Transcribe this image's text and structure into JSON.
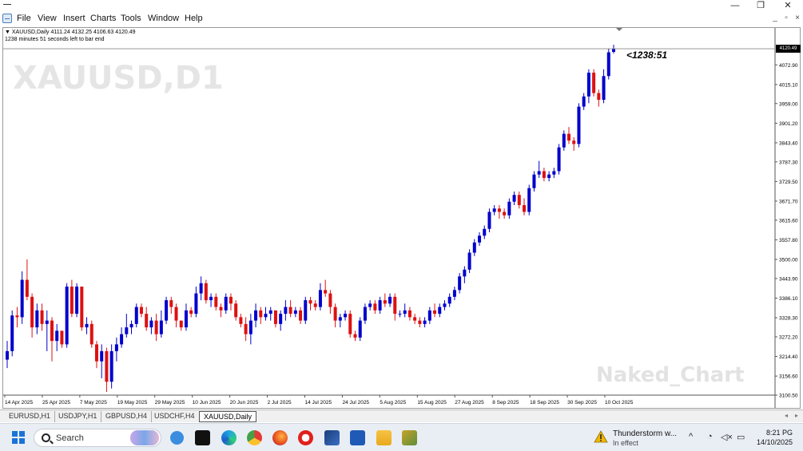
{
  "window": {
    "minimize": "—",
    "maximize": "❐",
    "close": "✕"
  },
  "menu": {
    "items": [
      "File",
      "View",
      "Insert",
      "Charts",
      "Tools",
      "Window",
      "Help"
    ],
    "mdi": [
      "_",
      "▫",
      "×"
    ]
  },
  "chart_header": {
    "line1": "▼ XAUUSD,Daily  4111.24 4132.25 4106.63 4120.49",
    "line2": "1238 minutes 51 seconds left to bar end"
  },
  "watermark": "XAUUSD,D1",
  "brand_watermark": "Naked_Chart",
  "countdown": "<1238:51",
  "current_price_label": "4120.49",
  "chart_data": {
    "type": "candlestick",
    "symbol": "XAUUSD",
    "timeframe": "D1",
    "y_ticks": [
      "4072.90",
      "4015.10",
      "3959.00",
      "3901.20",
      "3843.40",
      "3787.30",
      "3729.50",
      "3671.70",
      "3615.60",
      "3557.80",
      "3500.00",
      "3443.90",
      "3386.10",
      "3328.30",
      "3272.20",
      "3214.40",
      "3156.60",
      "3100.50"
    ],
    "y_range": [
      3100.5,
      4130
    ],
    "x_ticks": [
      "14 Apr 2025",
      "25 Apr 2025",
      "7 May 2025",
      "19 May 2025",
      "29 May 2025",
      "10 Jun 2025",
      "20 Jun 2025",
      "2 Jul 2025",
      "14 Jul 2025",
      "24 Jul 2025",
      "5 Aug 2025",
      "15 Aug 2025",
      "27 Aug 2025",
      "8 Sep 2025",
      "18 Sep 2025",
      "30 Sep 2025",
      "10 Oct 2025"
    ],
    "current_price": 4120.49,
    "up_color": "#0000cc",
    "down_color": "#dd1111",
    "candles": [
      [
        3205,
        3260,
        3180,
        3230
      ],
      [
        3230,
        3350,
        3215,
        3335
      ],
      [
        3335,
        3360,
        3300,
        3330
      ],
      [
        3330,
        3465,
        3310,
        3440
      ],
      [
        3440,
        3500,
        3380,
        3390
      ],
      [
        3390,
        3400,
        3270,
        3300
      ],
      [
        3300,
        3370,
        3280,
        3350
      ],
      [
        3350,
        3370,
        3290,
        3310
      ],
      [
        3310,
        3350,
        3230,
        3320
      ],
      [
        3320,
        3330,
        3200,
        3260
      ],
      [
        3260,
        3310,
        3230,
        3290
      ],
      [
        3290,
        3290,
        3240,
        3250
      ],
      [
        3250,
        3430,
        3240,
        3420
      ],
      [
        3420,
        3440,
        3330,
        3340
      ],
      [
        3340,
        3430,
        3330,
        3420
      ],
      [
        3420,
        3420,
        3290,
        3300
      ],
      [
        3300,
        3330,
        3280,
        3310
      ],
      [
        3310,
        3320,
        3240,
        3250
      ],
      [
        3250,
        3260,
        3180,
        3200
      ],
      [
        3200,
        3250,
        3150,
        3230
      ],
      [
        3230,
        3240,
        3110,
        3140
      ],
      [
        3140,
        3250,
        3120,
        3230
      ],
      [
        3230,
        3270,
        3200,
        3250
      ],
      [
        3250,
        3300,
        3240,
        3280
      ],
      [
        3280,
        3340,
        3270,
        3300
      ],
      [
        3300,
        3320,
        3280,
        3310
      ],
      [
        3310,
        3370,
        3300,
        3360
      ],
      [
        3360,
        3370,
        3330,
        3340
      ],
      [
        3340,
        3360,
        3290,
        3300
      ],
      [
        3300,
        3330,
        3280,
        3320
      ],
      [
        3320,
        3340,
        3260,
        3280
      ],
      [
        3280,
        3350,
        3270,
        3320
      ],
      [
        3320,
        3390,
        3310,
        3380
      ],
      [
        3380,
        3390,
        3340,
        3360
      ],
      [
        3360,
        3370,
        3300,
        3320
      ],
      [
        3320,
        3320,
        3290,
        3300
      ],
      [
        3300,
        3370,
        3290,
        3350
      ],
      [
        3350,
        3360,
        3330,
        3340
      ],
      [
        3340,
        3420,
        3330,
        3400
      ],
      [
        3400,
        3450,
        3380,
        3430
      ],
      [
        3430,
        3440,
        3370,
        3380
      ],
      [
        3380,
        3400,
        3360,
        3390
      ],
      [
        3390,
        3400,
        3350,
        3360
      ],
      [
        3360,
        3370,
        3330,
        3350
      ],
      [
        3350,
        3400,
        3340,
        3390
      ],
      [
        3390,
        3400,
        3350,
        3370
      ],
      [
        3370,
        3380,
        3320,
        3330
      ],
      [
        3330,
        3340,
        3300,
        3310
      ],
      [
        3310,
        3330,
        3260,
        3280
      ],
      [
        3280,
        3340,
        3250,
        3320
      ],
      [
        3320,
        3370,
        3300,
        3350
      ],
      [
        3350,
        3360,
        3310,
        3330
      ],
      [
        3330,
        3360,
        3320,
        3340
      ],
      [
        3340,
        3360,
        3320,
        3350
      ],
      [
        3350,
        3350,
        3300,
        3310
      ],
      [
        3310,
        3350,
        3290,
        3340
      ],
      [
        3340,
        3380,
        3320,
        3360
      ],
      [
        3360,
        3380,
        3330,
        3340
      ],
      [
        3340,
        3360,
        3330,
        3350
      ],
      [
        3350,
        3360,
        3310,
        3320
      ],
      [
        3320,
        3390,
        3310,
        3380
      ],
      [
        3380,
        3390,
        3350,
        3370
      ],
      [
        3370,
        3380,
        3350,
        3360
      ],
      [
        3360,
        3430,
        3350,
        3410
      ],
      [
        3410,
        3440,
        3390,
        3400
      ],
      [
        3400,
        3410,
        3340,
        3360
      ],
      [
        3360,
        3370,
        3300,
        3320
      ],
      [
        3320,
        3340,
        3300,
        3330
      ],
      [
        3330,
        3350,
        3320,
        3340
      ],
      [
        3340,
        3350,
        3270,
        3280
      ],
      [
        3280,
        3290,
        3260,
        3270
      ],
      [
        3270,
        3330,
        3260,
        3320
      ],
      [
        3320,
        3370,
        3310,
        3360
      ],
      [
        3360,
        3380,
        3350,
        3370
      ],
      [
        3370,
        3380,
        3340,
        3350
      ],
      [
        3350,
        3390,
        3340,
        3380
      ],
      [
        3380,
        3400,
        3360,
        3370
      ],
      [
        3370,
        3400,
        3360,
        3390
      ],
      [
        3390,
        3400,
        3320,
        3340
      ],
      [
        3340,
        3350,
        3330,
        3340
      ],
      [
        3340,
        3370,
        3330,
        3350
      ],
      [
        3350,
        3360,
        3320,
        3330
      ],
      [
        3330,
        3340,
        3310,
        3320
      ],
      [
        3320,
        3330,
        3300,
        3310
      ],
      [
        3310,
        3330,
        3300,
        3320
      ],
      [
        3320,
        3360,
        3310,
        3350
      ],
      [
        3350,
        3370,
        3330,
        3340
      ],
      [
        3340,
        3370,
        3330,
        3360
      ],
      [
        3360,
        3380,
        3350,
        3370
      ],
      [
        3370,
        3400,
        3360,
        3390
      ],
      [
        3390,
        3420,
        3380,
        3410
      ],
      [
        3410,
        3460,
        3400,
        3450
      ],
      [
        3450,
        3480,
        3430,
        3470
      ],
      [
        3470,
        3530,
        3460,
        3520
      ],
      [
        3520,
        3560,
        3510,
        3550
      ],
      [
        3550,
        3580,
        3540,
        3570
      ],
      [
        3570,
        3600,
        3560,
        3590
      ],
      [
        3590,
        3650,
        3580,
        3640
      ],
      [
        3640,
        3660,
        3630,
        3650
      ],
      [
        3650,
        3660,
        3620,
        3640
      ],
      [
        3640,
        3650,
        3620,
        3630
      ],
      [
        3630,
        3680,
        3620,
        3670
      ],
      [
        3670,
        3700,
        3660,
        3690
      ],
      [
        3690,
        3700,
        3650,
        3660
      ],
      [
        3660,
        3680,
        3630,
        3640
      ],
      [
        3640,
        3720,
        3630,
        3710
      ],
      [
        3710,
        3760,
        3700,
        3750
      ],
      [
        3750,
        3790,
        3740,
        3760
      ],
      [
        3760,
        3770,
        3730,
        3740
      ],
      [
        3740,
        3760,
        3730,
        3750
      ],
      [
        3750,
        3770,
        3740,
        3760
      ],
      [
        3760,
        3840,
        3750,
        3830
      ],
      [
        3830,
        3880,
        3820,
        3870
      ],
      [
        3870,
        3890,
        3840,
        3850
      ],
      [
        3850,
        3860,
        3820,
        3840
      ],
      [
        3840,
        3960,
        3830,
        3950
      ],
      [
        3950,
        3990,
        3940,
        3980
      ],
      [
        3980,
        4060,
        3960,
        4050
      ],
      [
        4050,
        4060,
        3980,
        3990
      ],
      [
        3990,
        4000,
        3950,
        3970
      ],
      [
        3970,
        4060,
        3960,
        4040
      ],
      [
        4040,
        4120,
        4030,
        4110
      ],
      [
        4111.24,
        4132.25,
        4106.63,
        4120.49
      ]
    ]
  },
  "tabs": [
    "EURUSD,H1",
    "USDJPY,H1",
    "GBPUSD,H4",
    "USDCHF,H4",
    "XAUUSD,Daily"
  ],
  "tab_scroll": [
    "◂",
    "▸"
  ],
  "taskbar": {
    "search_label": "Search",
    "weather_title": "Thunderstorm w...",
    "weather_status": "In effect",
    "time": "8:21 PG",
    "date": "14/10/2025",
    "tray": [
      "^",
      "◔",
      "◁×",
      "▭"
    ]
  }
}
